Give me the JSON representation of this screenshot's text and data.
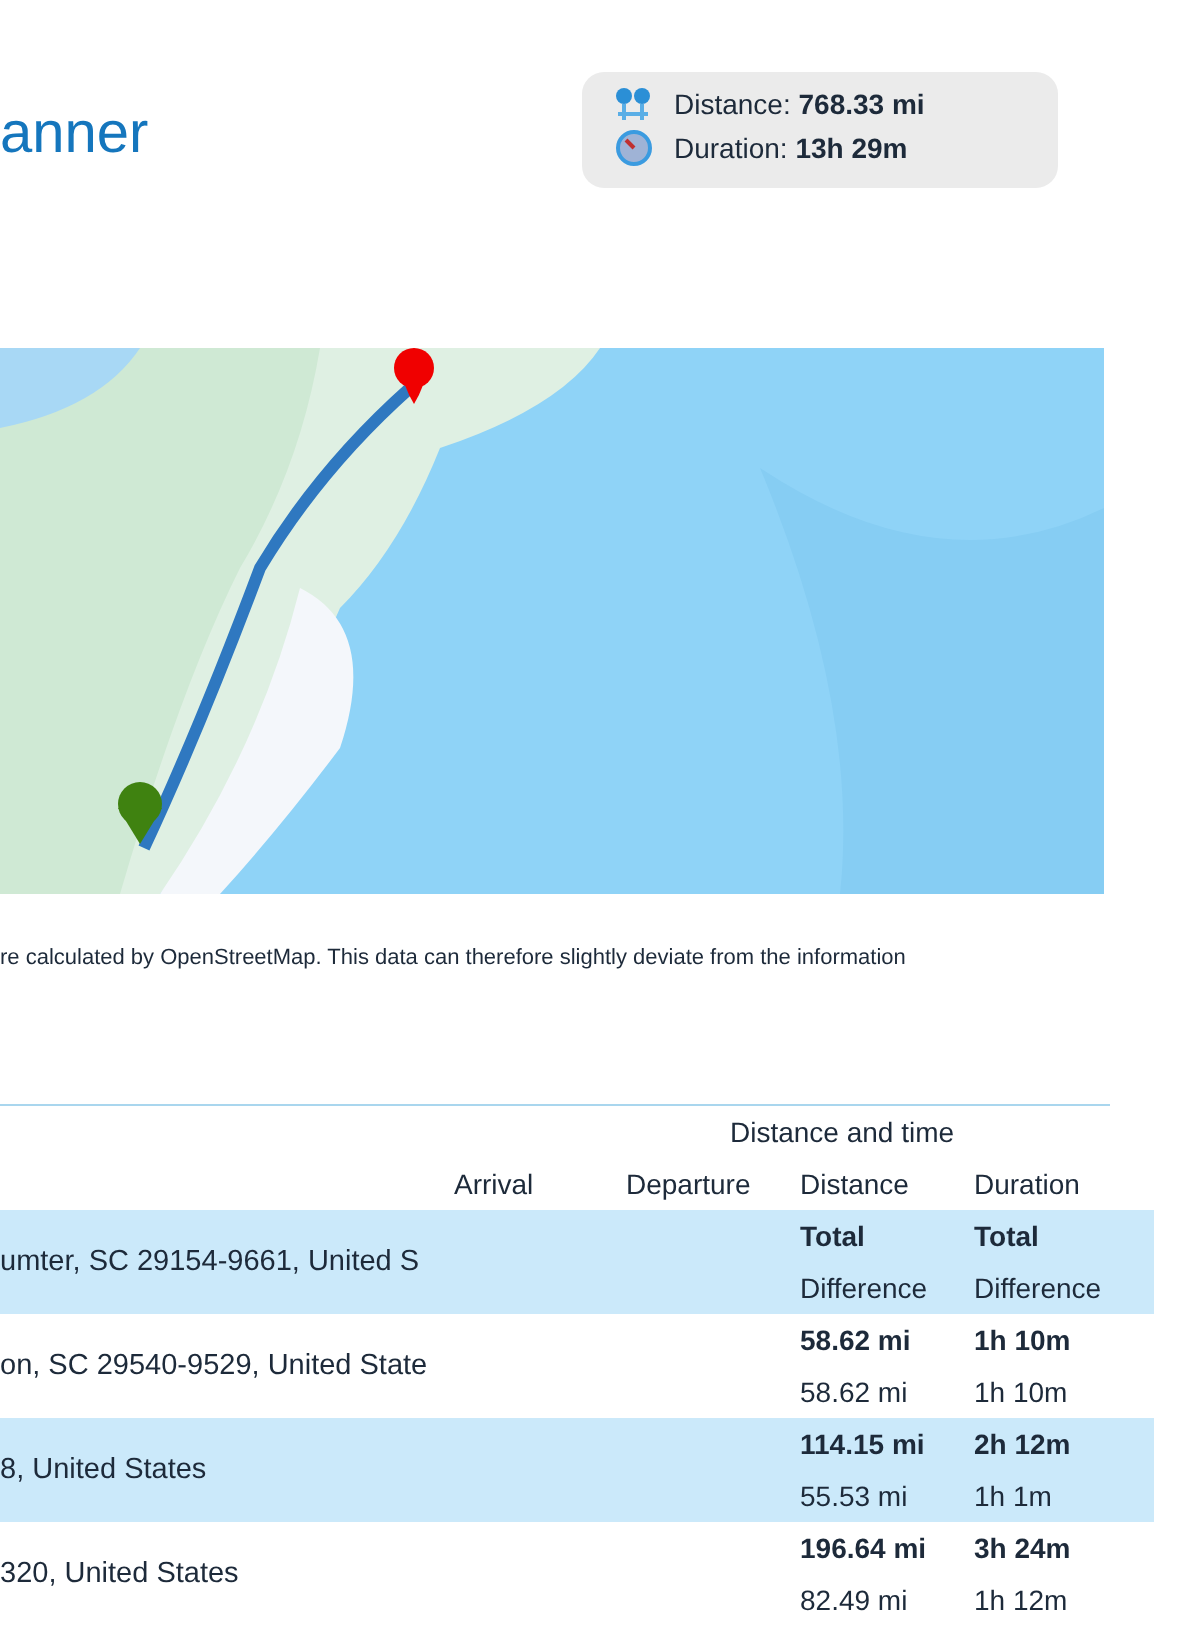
{
  "header": {
    "title": "anner",
    "summary": [
      {
        "kind": "distance",
        "label": "Distance:",
        "value": "768.33 mi"
      },
      {
        "kind": "duration",
        "label": "Duration:",
        "value": "13h 29m"
      }
    ]
  },
  "note": "re calculated by OpenStreetMap. This data can therefore slightly deviate from the information",
  "table": {
    "group_header": "Distance and time",
    "columns": [
      "Arrival",
      "Departure",
      "Distance",
      "Duration"
    ],
    "rows": [
      {
        "address": "umter, SC 29154-9661, United S",
        "distance_total": "Total",
        "distance_diff": "Difference",
        "duration_total": "Total",
        "duration_diff": "Difference"
      },
      {
        "address": "on, SC 29540-9529, United State",
        "distance_total": "58.62 mi",
        "distance_diff": "58.62 mi",
        "duration_total": "1h 10m",
        "duration_diff": "1h 10m"
      },
      {
        "address": "8, United States",
        "distance_total": "114.15 mi",
        "distance_diff": "55.53 mi",
        "duration_total": "2h 12m",
        "duration_diff": "1h 1m"
      },
      {
        "address": "320, United States",
        "distance_total": "196.64 mi",
        "distance_diff": "82.49 mi",
        "duration_total": "3h 24m",
        "duration_diff": "1h 12m"
      }
    ]
  }
}
